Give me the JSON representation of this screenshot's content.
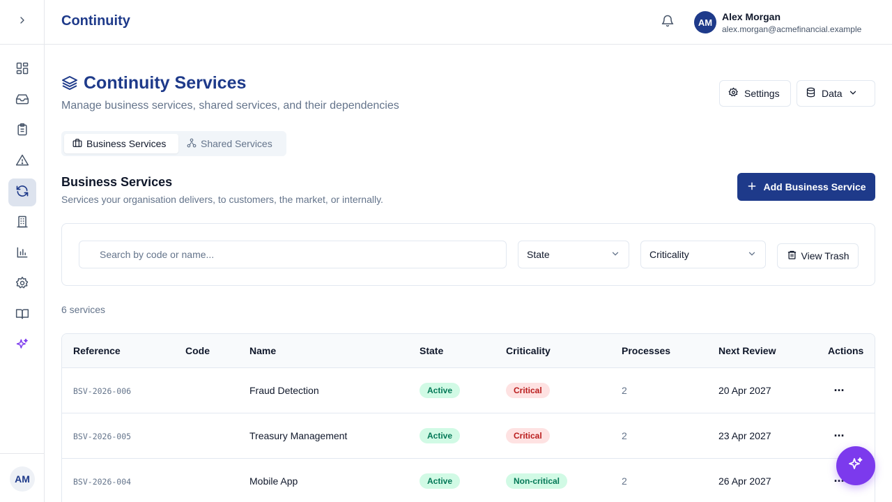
{
  "header": {
    "app_title": "Continuity",
    "user": {
      "initials": "AM",
      "name": "Alex Morgan",
      "email": "alex.morgan@acmefinancial.example"
    }
  },
  "sidebar": {
    "items": [
      {
        "icon": "dashboard-icon",
        "active": false
      },
      {
        "icon": "inbox-icon",
        "active": false
      },
      {
        "icon": "clipboard-icon",
        "active": false
      },
      {
        "icon": "warning-icon",
        "active": false
      },
      {
        "icon": "refresh-cycle-icon",
        "active": true
      },
      {
        "icon": "building-icon",
        "active": false
      },
      {
        "icon": "bar-chart-icon",
        "active": false
      },
      {
        "icon": "gear-icon",
        "active": false
      },
      {
        "icon": "book-icon",
        "active": false
      },
      {
        "icon": "sparkles-icon",
        "active": false
      }
    ],
    "avatar_initials": "AM"
  },
  "page": {
    "title": "Continuity Services",
    "subtitle": "Manage business services, shared services, and their dependencies",
    "settings_label": "Settings",
    "data_label": "Data"
  },
  "tabs": [
    {
      "label": "Business Services",
      "active": true
    },
    {
      "label": "Shared Services",
      "active": false
    }
  ],
  "section": {
    "title": "Business Services",
    "subtitle": "Services your organisation delivers, to customers, the market, or internally.",
    "add_label": "Add Business Service"
  },
  "filters": {
    "search_placeholder": "Search by code or name...",
    "state_label": "State",
    "criticality_label": "Criticality",
    "trash_label": "View Trash"
  },
  "count_label": "6 services",
  "table": {
    "columns": [
      "Reference",
      "Code",
      "Name",
      "State",
      "Criticality",
      "Processes",
      "Next Review",
      "Actions"
    ],
    "rows": [
      {
        "reference": "BSV-2026-006",
        "code": "",
        "name": "Fraud Detection",
        "state": "Active",
        "criticality": "Critical",
        "processes": "2",
        "next_review": "20 Apr 2027"
      },
      {
        "reference": "BSV-2026-005",
        "code": "",
        "name": "Treasury Management",
        "state": "Active",
        "criticality": "Critical",
        "processes": "2",
        "next_review": "23 Apr 2027"
      },
      {
        "reference": "BSV-2026-004",
        "code": "",
        "name": "Mobile App",
        "state": "Active",
        "criticality": "Non-critical",
        "processes": "2",
        "next_review": "26 Apr 2027"
      }
    ]
  },
  "colors": {
    "brand": "#1e3a8a",
    "accent_purple": "#7c3aed",
    "active_badge_bg": "#d1fae5",
    "critical_badge_bg": "#fee2e2"
  }
}
